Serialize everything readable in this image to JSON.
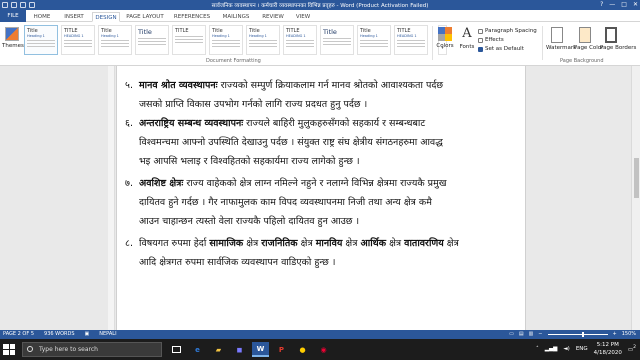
{
  "title_bar": {
    "title": "सार्वजनिक व्यवस्थापन । कर्मचारी व्यवस्थापनका विभिन्न प्रवृहरु - Word (Product Activation Failed)",
    "window_buttons": [
      "?",
      "—",
      "□",
      "✕"
    ]
  },
  "tabs": [
    "FILE",
    "HOME",
    "INSERT",
    "DESIGN",
    "PAGE LAYOUT",
    "REFERENCES",
    "MAILINGS",
    "REVIEW",
    "VIEW"
  ],
  "active_tab": "DESIGN",
  "ribbon": {
    "themes_label": "Themes",
    "gallery": [
      {
        "title": "Title",
        "heading": "Heading 1",
        "style": "small"
      },
      {
        "title": "TITLE",
        "heading": "HEADING 1",
        "style": "small"
      },
      {
        "title": "Title",
        "heading": "Heading 1",
        "style": "small"
      },
      {
        "title": "Title",
        "heading": "",
        "style": "big"
      },
      {
        "title": "TITLE",
        "heading": "",
        "style": "small"
      },
      {
        "title": "Title",
        "heading": "Heading 1",
        "style": "small"
      },
      {
        "title": "Title",
        "heading": "Heading 1",
        "style": "small"
      },
      {
        "title": "TITLE",
        "heading": "HEADING 1",
        "style": "small"
      },
      {
        "title": "Title",
        "heading": "",
        "style": "big"
      },
      {
        "title": "Title",
        "heading": "Heading 1",
        "style": "small"
      },
      {
        "title": "TITLE",
        "heading": "HEADING 1",
        "style": "small"
      }
    ],
    "document_formatting_label": "Document Formatting",
    "colors_label": "Colors",
    "fonts_label": "Fonts",
    "paragraph_spacing_label": "Paragraph Spacing",
    "effects_label": "Effects",
    "set_as_default_label": "Set as Default",
    "watermark_label": "Watermark",
    "page_color_label": "Page Color",
    "page_borders_label": "Page Borders",
    "page_background_label": "Page Background"
  },
  "document": {
    "items": [
      {
        "number": "५.",
        "lines": [
          [
            {
              "b": "मानव श्रोत व्यवस्थापनः"
            },
            {
              "t": " राज्यको सम्पुर्ण क्रियाकलाम गर्न मानव श्रोतको आवाश्यकता पर्दछ"
            }
          ],
          [
            {
              "t": "जसको प्राप्ति विकास उपभोग गर्नको लागि राज्य प्रदधत हुनु पर्दछ ।"
            }
          ]
        ]
      },
      {
        "number": "६.",
        "lines": [
          [
            {
              "b": "अन्तराष्ट्रिय सम्बन्ध व्यवस्थापनः"
            },
            {
              "t": " राज्यले बाहिरी मुलुकहरुसँगको सहकार्य र सम्बन्धबाट"
            }
          ],
          [
            {
              "t": "विश्वमन्चमा आफ्नो उपस्थिति देखाउनु पर्दछ । संयुक्त राष्ट्र संघ क्षेत्रीय संगठनहरुमा आवद्ध"
            }
          ],
          [
            {
              "t": "भइ आपसि भलाइ र विश्वहितको सहकार्यमा राज्य लागेको हुन्छ ।"
            }
          ]
        ]
      },
      {
        "number": "७.",
        "lines": [
          [
            {
              "b": "अवशिष्ट क्षेत्रः"
            },
            {
              "t": " राज्य वाहेकको क्षेत्र लाग्न नमिल्ने नहुने र नलाग्ने विभिन्न क्षेत्रमा राज्यकै प्रमुख"
            }
          ],
          [
            {
              "t": "दायितव हुने गर्दछ । गैर नाफामुलक काम विपद व्यवस्थापनमा निजी तथा अन्य क्षेत्र कमै"
            }
          ],
          [
            {
              "t": "आउन चाहान्छन त्यस्तो वेला राज्यकै पहिलो दायितव हुन आउछ ।"
            }
          ]
        ]
      },
      {
        "number": "८.",
        "lines": [
          [
            {
              "t": "विषयगत रुपमा हेर्दा "
            },
            {
              "b": "सामाजिक"
            },
            {
              "t": " क्षेत्र "
            },
            {
              "b": "राजनितिक"
            },
            {
              "t": " क्षेत्र "
            },
            {
              "b": "मानविय"
            },
            {
              "t": " क्षेत्र "
            },
            {
              "b": "आर्थिक"
            },
            {
              "t": " क्षेत्र "
            },
            {
              "b": "वातावरणिय"
            },
            {
              "t": " क्षेत्र"
            }
          ],
          [
            {
              "t": "आदि क्षेत्रगत रुपमा सार्वजिक व्यवस्थापन वाडिएको हुन्छ ।"
            }
          ]
        ]
      }
    ]
  },
  "status_bar": {
    "page": "PAGE 2 OF 5",
    "words": "936 WORDS",
    "language": "NEPALI",
    "zoom": "150%",
    "zoom_fraction": 0.6
  },
  "taskbar": {
    "search_placeholder": "Type here to search",
    "language": "ENG",
    "time": "5:12 PM",
    "date": "4/18/2020",
    "notification_count": "2"
  },
  "colors": {
    "accent": "#2b579a",
    "taskbar": "#1c1c1c"
  }
}
